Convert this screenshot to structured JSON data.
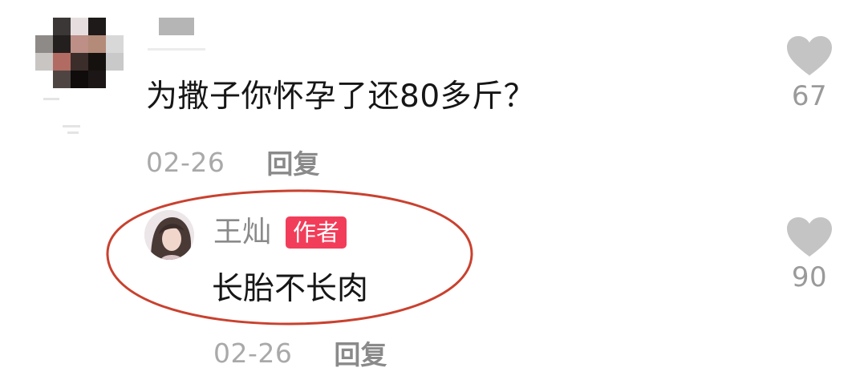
{
  "comments": [
    {
      "username": "",
      "text": "为撒子你怀孕了还80多斤？",
      "date": "02-26",
      "reply_label": "回复",
      "like_count": "67",
      "liked": false
    }
  ],
  "replies": [
    {
      "username": "王灿",
      "badge": "作者",
      "text": "长胎不长肉",
      "date": "02-26",
      "reply_label": "回复",
      "like_count": "90",
      "liked": false
    }
  ],
  "icons": {
    "like": "heart-icon",
    "avatar_redacted": "mosaic-avatar"
  },
  "colors": {
    "badge": "#f23d5a",
    "highlight_outline": "#c9412f",
    "muted_text": "#a9a9a9",
    "heart": "#c4c4c4"
  }
}
